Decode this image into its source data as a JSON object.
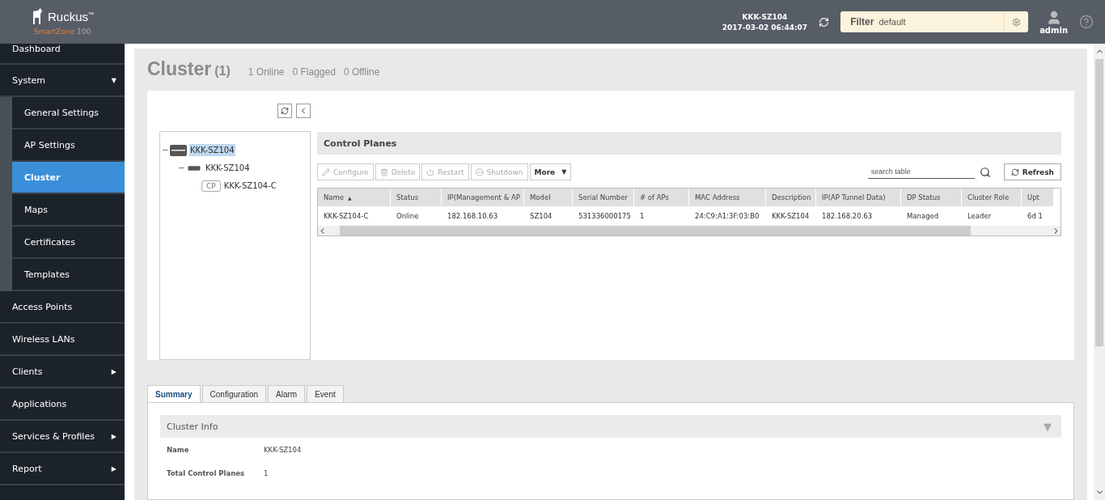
{
  "header": {
    "brand": "Ruckus",
    "trademark": "™",
    "product": "SmartZone",
    "model": "100",
    "cluster_name": "KKK-SZ104",
    "datetime": "2017-03-02  06:44:07",
    "filter_label": "Filter",
    "filter_value": "default",
    "user": "admin"
  },
  "sidebar": {
    "items": [
      {
        "label": "Dashboard",
        "selected": false
      },
      {
        "label": "System",
        "selected": false,
        "arrow": "▼",
        "children": [
          {
            "label": "General Settings",
            "selected": false
          },
          {
            "label": "AP Settings",
            "selected": false
          },
          {
            "label": "Cluster",
            "selected": true
          },
          {
            "label": "Maps",
            "selected": false
          },
          {
            "label": "Certificates",
            "selected": false
          },
          {
            "label": "Templates",
            "selected": false
          }
        ]
      },
      {
        "label": "Access Points",
        "selected": false
      },
      {
        "label": "Wireless LANs",
        "selected": false
      },
      {
        "label": "Clients",
        "selected": false,
        "arrow": "▶"
      },
      {
        "label": "Applications",
        "selected": false
      },
      {
        "label": "Services & Profiles",
        "selected": false,
        "arrow": "▶"
      },
      {
        "label": "Report",
        "selected": false,
        "arrow": "▶"
      }
    ]
  },
  "page": {
    "title": "Cluster",
    "count": "(1)",
    "stats": [
      "1 Online",
      "0 Flagged",
      "0 Offline"
    ]
  },
  "tree": {
    "nodes": [
      {
        "label": "KKK-SZ104",
        "kind": "cluster",
        "selected": true,
        "toggle": "−",
        "children": [
          {
            "label": "KKK-SZ104",
            "kind": "node",
            "selected": false,
            "toggle": "−",
            "children": [
              {
                "label": "KKK-SZ104-C",
                "kind": "cp",
                "badge": "CP",
                "selected": false
              }
            ]
          }
        ]
      }
    ]
  },
  "control_planes": {
    "title": "Control Planes",
    "actions": [
      {
        "label": "Configure",
        "kind": "edit",
        "disabled": true
      },
      {
        "label": "Delete",
        "kind": "trash",
        "disabled": true
      },
      {
        "label": "Restart",
        "kind": "power",
        "disabled": true
      },
      {
        "label": "Shutdown",
        "kind": "stop",
        "disabled": true
      },
      {
        "label": "More",
        "kind": "menu",
        "caret": "▼",
        "disabled": false
      }
    ],
    "search": {
      "placeholder": "search table"
    },
    "refresh": "Refresh",
    "table": {
      "sort_indicator": "▲",
      "columns": [
        "Name",
        "Status",
        "IP(Management & AP",
        "Model",
        "Serial Number",
        "# of APs",
        "MAC Address",
        "Description",
        "IP(AP Tunnel Data)",
        "DP Status",
        "Cluster Role",
        "Upt"
      ],
      "rows": [
        [
          "KKK-SZ104-C",
          "Online",
          "182.168.10.63",
          "SZ104",
          "531336000175",
          "1",
          "24:C9:A1:3F:03:B0",
          "KKK-SZ104",
          "182.168.20.63",
          "Managed",
          "Leader",
          "6d 1"
        ]
      ]
    }
  },
  "tabs": [
    {
      "label": "Summary",
      "selected": true
    },
    {
      "label": "Configuration",
      "selected": false
    },
    {
      "label": "Alarm",
      "selected": false
    },
    {
      "label": "Event",
      "selected": false
    }
  ],
  "summary": {
    "title": "Cluster Info",
    "toggle": "▼",
    "fields": [
      {
        "label": "Name",
        "value": "KKK-SZ104"
      },
      {
        "label": "Total Control Planes",
        "value": "1"
      }
    ]
  }
}
